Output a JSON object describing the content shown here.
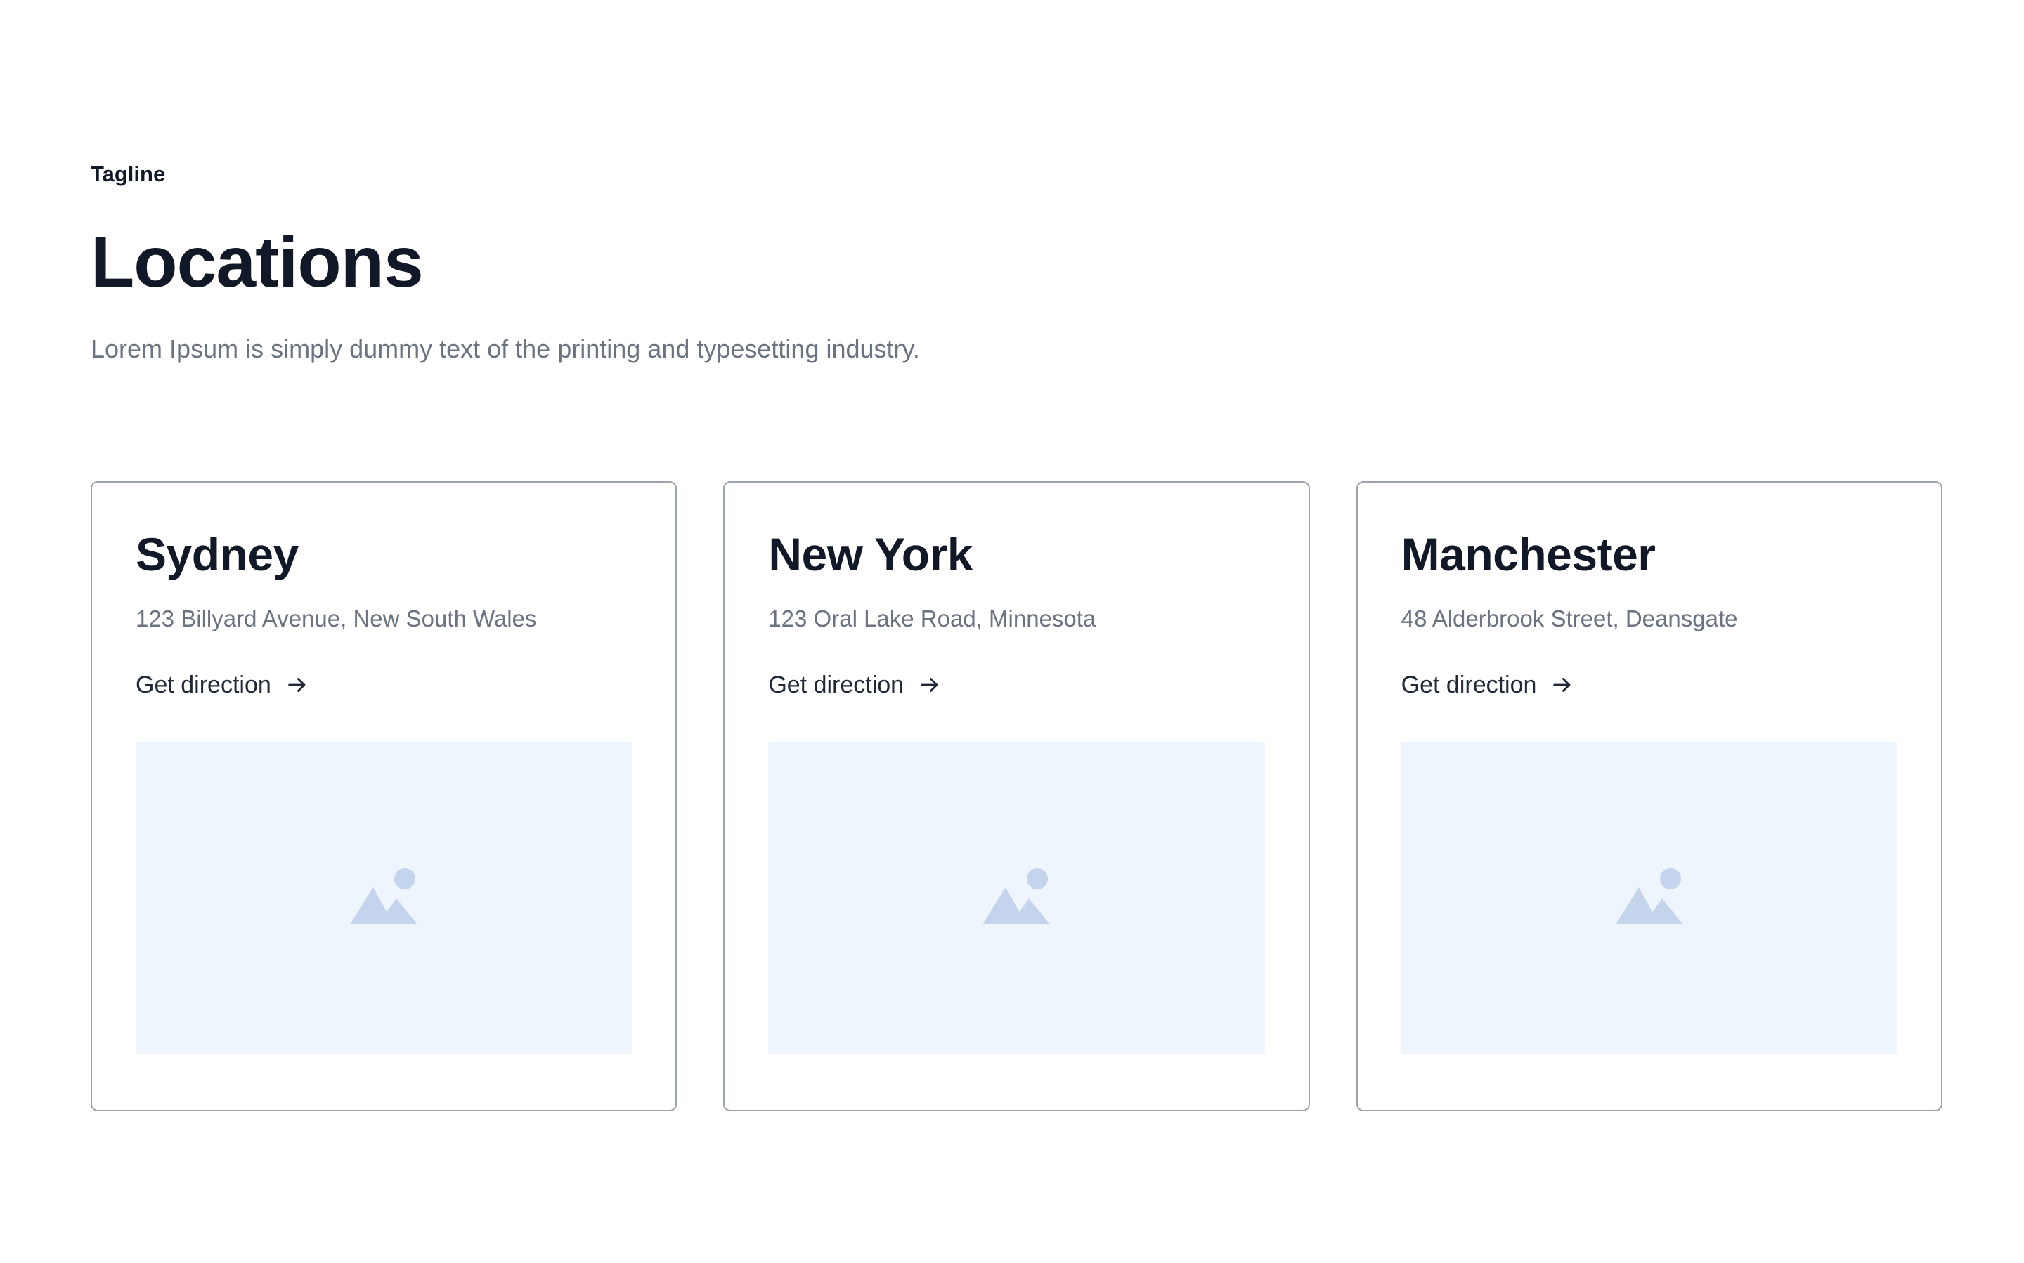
{
  "header": {
    "tagline": "Tagline",
    "title": "Locations",
    "subtitle": "Lorem Ipsum is simply dummy text of the printing and typesetting industry."
  },
  "locations": [
    {
      "city": "Sydney",
      "address": "123 Billyard Avenue, New South Wales",
      "link_label": "Get direction",
      "link_icon": "arrow-right-icon",
      "image_icon": "image-placeholder-icon"
    },
    {
      "city": "New York",
      "address": "123 Oral Lake Road, Minnesota",
      "link_label": "Get direction",
      "link_icon": "arrow-right-icon",
      "image_icon": "image-placeholder-icon"
    },
    {
      "city": "Manchester",
      "address": "48 Alderbrook Street, Deansgate",
      "link_label": "Get direction",
      "link_icon": "arrow-right-icon",
      "image_icon": "image-placeholder-icon"
    }
  ],
  "colors": {
    "heading": "#111827",
    "muted_text": "#6b7280",
    "card_border": "#9ca3af",
    "image_bg": "#eef5fd",
    "image_icon": "#c3d4ec"
  }
}
